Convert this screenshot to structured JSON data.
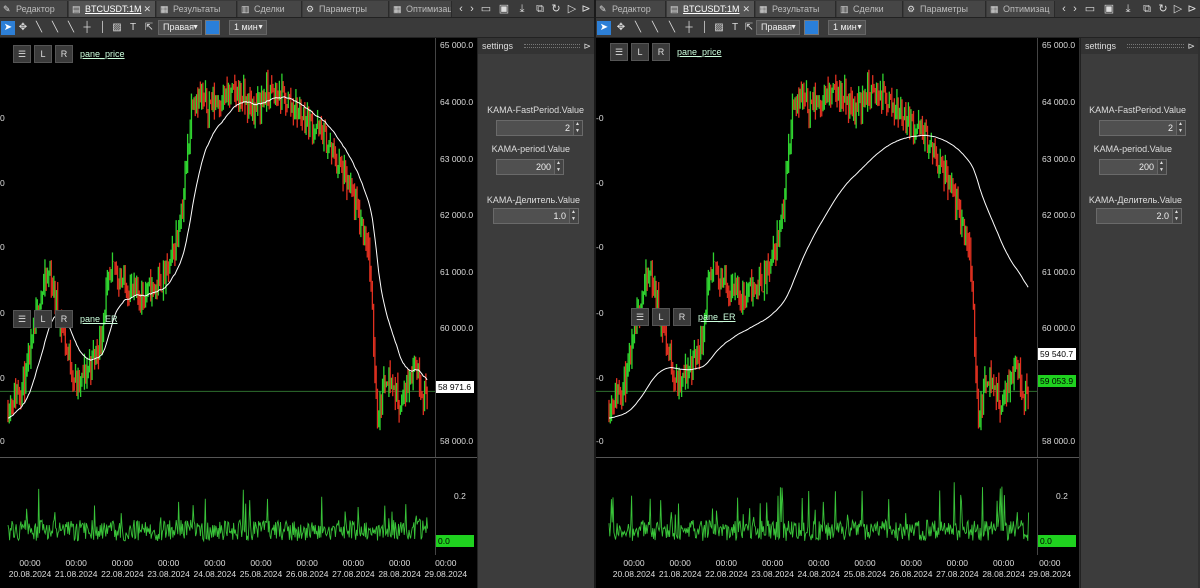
{
  "left": {
    "tabs": [
      {
        "label": "Редактор",
        "icon": "pencil-icon"
      },
      {
        "label": "BTCUSDT:1M",
        "icon": "chart-icon"
      },
      {
        "label": "Результаты",
        "icon": "results-icon"
      },
      {
        "label": "Сделки",
        "icon": "deals-icon"
      },
      {
        "label": "Параметры",
        "icon": "gear-icon"
      },
      {
        "label": "Оптимизац",
        "icon": "optimization-icon"
      }
    ],
    "toolbar": {
      "align_label": "Правая",
      "timeframe_label": "1 мин"
    },
    "price_pane_label": "pane_price",
    "er_pane_label": "pane_ER",
    "price_ticks": [
      "65 000.0",
      "64 000.0",
      "63 000.0",
      "62 000.0",
      "61 000.0",
      "60 000.0",
      "58 000.0"
    ],
    "current_badge": "58 971.6",
    "er_ticks": [
      "0.2"
    ],
    "er_badge": "0.0",
    "left_axis": [
      "0",
      "0",
      "0",
      "0",
      "0",
      "0",
      "0"
    ],
    "settings": {
      "title": "settings",
      "params": [
        {
          "label": "KAMA-FastPeriod.Value",
          "value": "2"
        },
        {
          "label": "KAMA-period.Value",
          "value": "200"
        },
        {
          "label": "KAMA-Делитель.Value",
          "value": "1.0"
        }
      ]
    }
  },
  "right": {
    "tabs": [
      {
        "label": "Редактор",
        "icon": "pencil-icon"
      },
      {
        "label": "BTCUSDT:1M",
        "icon": "chart-icon"
      },
      {
        "label": "Результаты",
        "icon": "results-icon"
      },
      {
        "label": "Сделки",
        "icon": "deals-icon"
      },
      {
        "label": "Параметры",
        "icon": "gear-icon"
      },
      {
        "label": "Оптимизац",
        "icon": "optimization-icon"
      }
    ],
    "toolbar": {
      "align_label": "Правая",
      "timeframe_label": "1 мин"
    },
    "price_pane_label": "pane_price",
    "er_pane_label": "pane_ER",
    "price_ticks": [
      "65 000.0",
      "64 000.0",
      "63 000.0",
      "62 000.0",
      "61 000.0",
      "60 000.0",
      "58 000.0"
    ],
    "kama_badge": "59 540.7",
    "current_badge": "59 053.9",
    "er_ticks": [
      "0.2"
    ],
    "er_badge": "0.0",
    "left_axis": [
      "-0",
      "-0",
      "-0",
      "-0",
      "-0",
      "-0",
      "-0"
    ],
    "settings": {
      "title": "settings",
      "params": [
        {
          "label": "KAMA-FastPeriod.Value",
          "value": "2"
        },
        {
          "label": "KAMA-period.Value",
          "value": "200"
        },
        {
          "label": "KAMA-Делитель.Value",
          "value": "2.0"
        }
      ]
    }
  },
  "time_labels": [
    {
      "time": "00:00",
      "date": "20.08.2024"
    },
    {
      "time": "00:00",
      "date": "21.08.2024"
    },
    {
      "time": "00:00",
      "date": "22.08.2024"
    },
    {
      "time": "00:00",
      "date": "23.08.2024"
    },
    {
      "time": "00:00",
      "date": "24.08.2024"
    },
    {
      "time": "00:00",
      "date": "25.08.2024"
    },
    {
      "time": "00:00",
      "date": "26.08.2024"
    },
    {
      "time": "00:00",
      "date": "27.08.2024"
    },
    {
      "time": "00:00",
      "date": "28.08.2024"
    },
    {
      "time": "00:00",
      "date": "29.08.2024"
    }
  ],
  "colors": {
    "up": "#2fd32f",
    "down": "#e03020",
    "kama": "#ffffff",
    "er_line": "#39c339",
    "badge_green": "#1fd11f",
    "hline": "#2e6e2e"
  },
  "chart_data": {
    "type": "line",
    "x_dates": [
      "20.08.2024",
      "21.08.2024",
      "22.08.2024",
      "23.08.2024",
      "24.08.2024",
      "25.08.2024",
      "26.08.2024",
      "27.08.2024",
      "28.08.2024",
      "29.08.2024"
    ],
    "price_ylim": [
      57800,
      65050
    ],
    "price_path": [
      [
        0,
        58700
      ],
      [
        0.4,
        59200
      ],
      [
        0.7,
        60600
      ],
      [
        0.9,
        61000
      ],
      [
        1.1,
        60300
      ],
      [
        1.3,
        59600
      ],
      [
        1.5,
        59000
      ],
      [
        1.7,
        59300
      ],
      [
        2.0,
        59800
      ],
      [
        2.1,
        60500
      ],
      [
        2.3,
        61100
      ],
      [
        2.5,
        60800
      ],
      [
        2.8,
        60600
      ],
      [
        3.1,
        60700
      ],
      [
        3.4,
        60900
      ],
      [
        3.6,
        61400
      ],
      [
        3.8,
        62300
      ],
      [
        4.0,
        64100
      ],
      [
        4.3,
        63900
      ],
      [
        4.6,
        64000
      ],
      [
        5.0,
        64100
      ],
      [
        5.3,
        63800
      ],
      [
        5.6,
        64100
      ],
      [
        6.0,
        64000
      ],
      [
        6.4,
        63700
      ],
      [
        6.8,
        63400
      ],
      [
        7.2,
        62800
      ],
      [
        7.5,
        62200
      ],
      [
        7.8,
        61500
      ],
      [
        8.0,
        58500
      ],
      [
        8.2,
        59300
      ],
      [
        8.5,
        58700
      ],
      [
        8.8,
        59500
      ],
      [
        9.0,
        58900
      ]
    ],
    "kama_ylim": [
      57800,
      65050
    ],
    "er_values_max": 0.3
  }
}
